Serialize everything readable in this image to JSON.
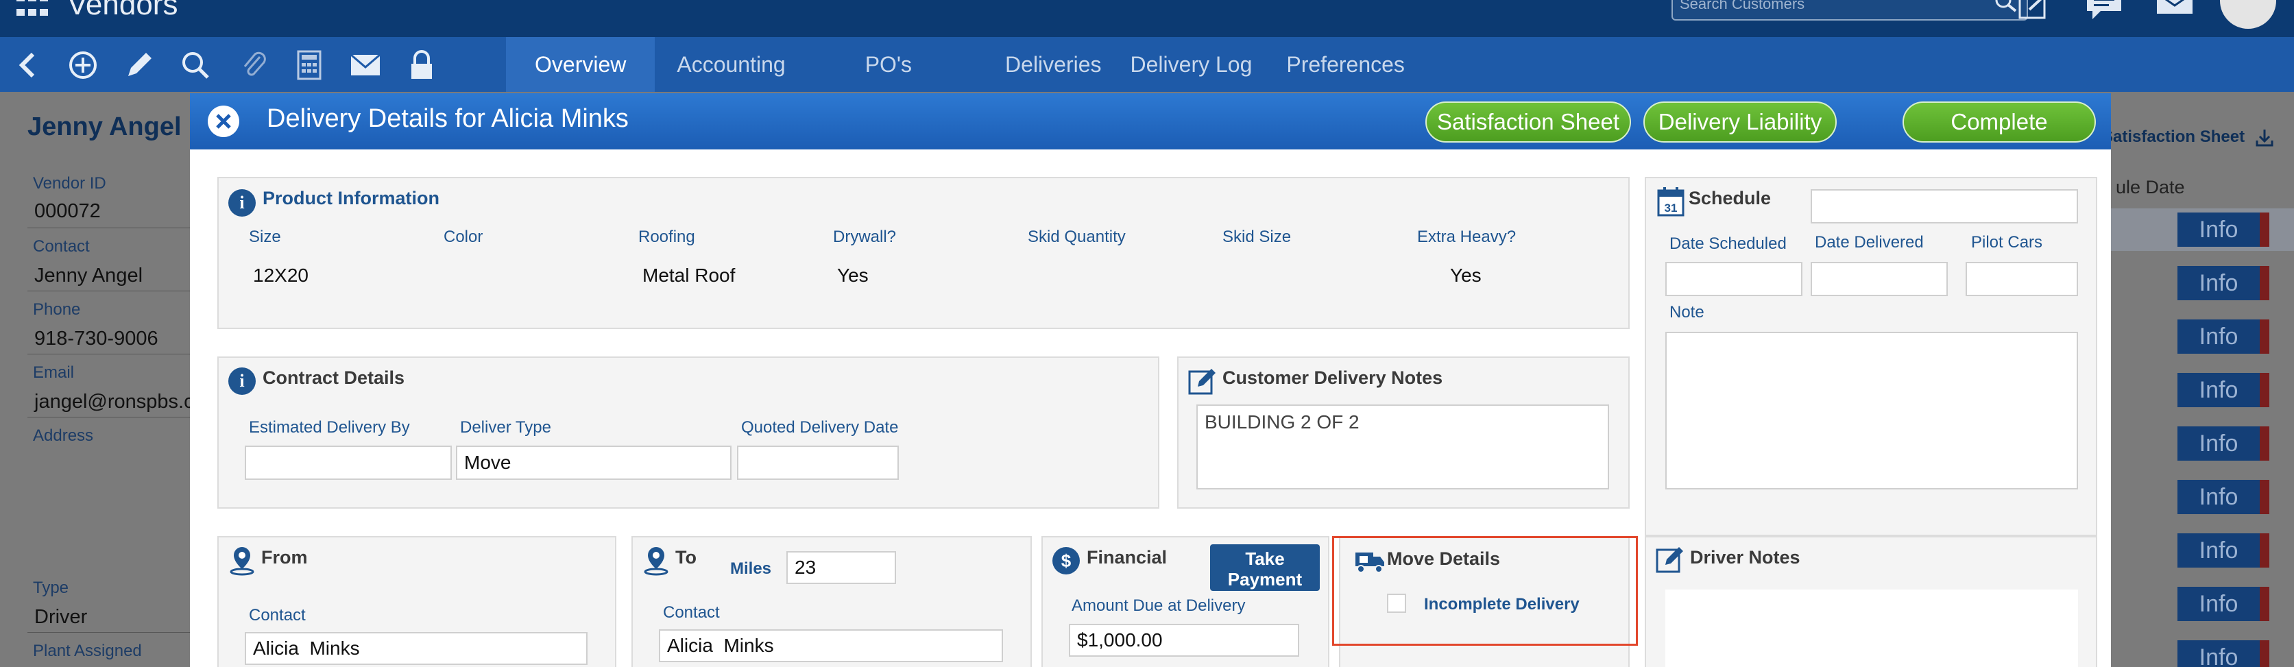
{
  "app": {
    "title": "Vendors",
    "search_placeholder": "Search Customers"
  },
  "tabs": [
    "Overview",
    "Accounting",
    "PO's",
    "Deliveries",
    "Delivery Log",
    "Preferences"
  ],
  "vendor": {
    "name": "Jenny Angel",
    "fields": [
      {
        "label": "Vendor ID",
        "value": "000072"
      },
      {
        "label": "Contact",
        "value": "Jenny Angel"
      },
      {
        "label": "Phone",
        "value": "918-730-9006"
      },
      {
        "label": "Email",
        "value": "jangel@ronspbs.co"
      },
      {
        "label": "Address",
        "value": ""
      },
      {
        "label": "Type",
        "value": "Driver"
      },
      {
        "label": "Plant Assigned",
        "value": ""
      }
    ],
    "satisfaction_sheet": "Satisfaction Sheet",
    "column_header": "ule Date",
    "info_label": "Info"
  },
  "modal": {
    "title": "Delivery Details for Alicia  Minks",
    "buttons": {
      "satisfaction": "Satisfaction Sheet",
      "liability": "Delivery Liability",
      "complete": "Complete"
    },
    "product": {
      "title": "Product Information",
      "labels": [
        "Size",
        "Color",
        "Roofing",
        "Drywall?",
        "Skid Quantity",
        "Skid Size",
        "Extra Heavy?"
      ],
      "values": [
        "12X20",
        "",
        "Metal Roof",
        "Yes",
        "",
        "",
        "Yes"
      ]
    },
    "schedule": {
      "title": "Schedule",
      "date_scheduled": "Date Scheduled",
      "date_delivered": "Date Delivered",
      "pilot_cars": "Pilot Cars",
      "note": "Note"
    },
    "contract": {
      "title": "Contract Details",
      "estimated_label": "Estimated Delivery By",
      "deliver_type_label": "Deliver Type",
      "deliver_type_value": "Move",
      "quoted_label": "Quoted Delivery Date"
    },
    "customer_notes": {
      "title": "Customer Delivery Notes",
      "text": "BUILDING 2 OF 2"
    },
    "from": {
      "title": "From",
      "contact_label": "Contact",
      "contact_value": "Alicia  Minks"
    },
    "to": {
      "title": "To",
      "miles_label": "Miles",
      "miles_value": "23",
      "contact_label": "Contact",
      "contact_value": "Alicia  Minks"
    },
    "financial": {
      "title": "Financial",
      "take_payment": "Take\nPayment",
      "amount_label": "Amount Due at Delivery",
      "amount_value": "$1,000.00"
    },
    "move": {
      "title": "Move Details",
      "incomplete_label": "Incomplete Delivery"
    },
    "driver_notes": {
      "title": "Driver Notes"
    }
  },
  "colors": {
    "topbar": "#0c3a72",
    "toolbar": "#1e5aa8",
    "header": "#1c5db4",
    "green_button": "#5cae2b",
    "label_blue": "#1f5590",
    "highlight_red": "#e2472c"
  }
}
